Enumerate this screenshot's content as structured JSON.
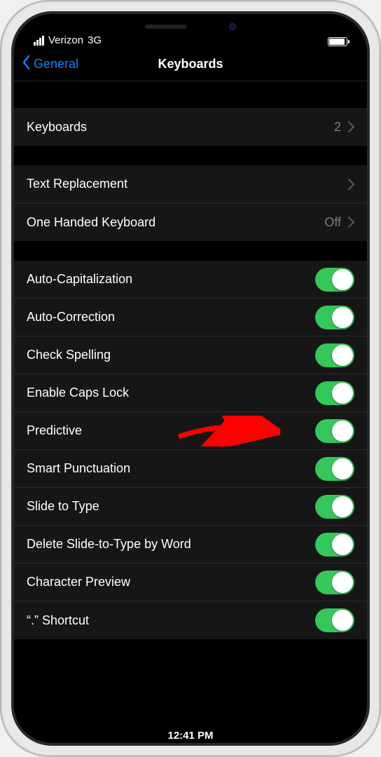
{
  "status": {
    "carrier": "Verizon",
    "network": "3G",
    "time": "12:41 PM"
  },
  "nav": {
    "back": "General",
    "title": "Keyboards"
  },
  "groups": {
    "keyboards": {
      "label": "Keyboards",
      "count": "2"
    },
    "text_row": {
      "text_replacement": "Text Replacement",
      "one_handed": "One Handed Keyboard",
      "one_handed_value": "Off"
    },
    "toggles": [
      {
        "label": "Auto-Capitalization",
        "on": true
      },
      {
        "label": "Auto-Correction",
        "on": true
      },
      {
        "label": "Check Spelling",
        "on": true
      },
      {
        "label": "Enable Caps Lock",
        "on": true
      },
      {
        "label": "Predictive",
        "on": true,
        "highlight": true
      },
      {
        "label": "Smart Punctuation",
        "on": true
      },
      {
        "label": "Slide to Type",
        "on": true
      },
      {
        "label": "Delete Slide-to-Type by Word",
        "on": true
      },
      {
        "label": "Character Preview",
        "on": true
      },
      {
        "label": "“.” Shortcut",
        "on": true
      }
    ]
  }
}
